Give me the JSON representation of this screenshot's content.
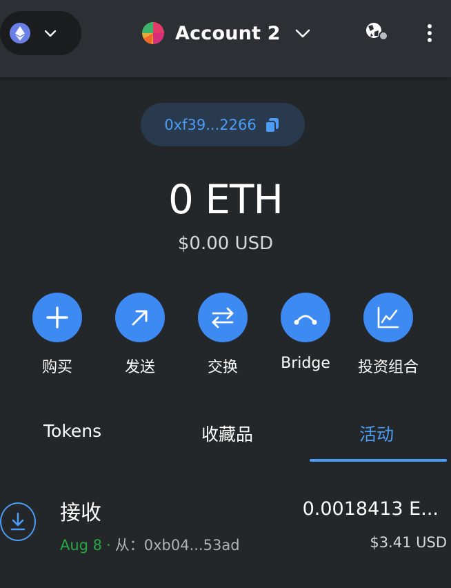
{
  "header": {
    "network_icon": "ethereum-icon",
    "account_name": "Account 2",
    "menu_icon": "kebab-menu-icon",
    "connection_icon": "globe-connection-icon"
  },
  "address": {
    "short": "0xf39...2266",
    "copy_icon": "copy-icon"
  },
  "balance": {
    "amount": "0 ETH",
    "fiat": "$0.00 USD"
  },
  "actions": [
    {
      "label": "购买",
      "icon": "plus-icon"
    },
    {
      "label": "发送",
      "icon": "arrow-up-right-icon"
    },
    {
      "label": "交换",
      "icon": "swap-arrows-icon"
    },
    {
      "label": "Bridge",
      "icon": "bridge-icon"
    },
    {
      "label": "投资组合",
      "icon": "chart-line-icon"
    }
  ],
  "tabs": [
    {
      "label": "Tokens",
      "active": false
    },
    {
      "label": "收藏品",
      "active": false
    },
    {
      "label": "活动",
      "active": true
    }
  ],
  "colors": {
    "accent": "#4b9cf5",
    "action_bg": "#3d8bf2",
    "background": "#24272a",
    "success": "#28a745"
  },
  "activity": [
    {
      "title": "接收",
      "date": "Aug 8",
      "separator": "·",
      "from_label": "从：",
      "from_address": "0xb04...53ad",
      "amount": "0.0018413 E...",
      "fiat": "$3.41 USD",
      "icon": "receive-download-icon"
    }
  ]
}
